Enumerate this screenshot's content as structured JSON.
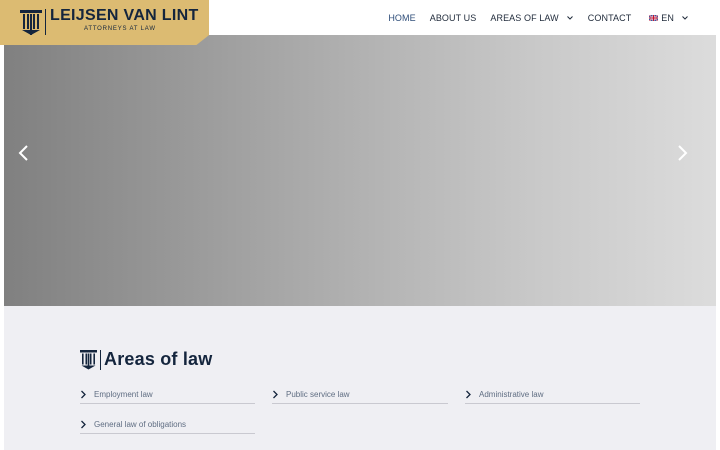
{
  "brand": {
    "name": "LEIJSEN VAN LINT",
    "tagline": "ATTORNEYS AT LAW",
    "color_gold": "#dcbb72",
    "color_navy": "#14253d"
  },
  "nav": {
    "items": [
      {
        "label": "HOME",
        "active": true
      },
      {
        "label": "ABOUT US",
        "active": false
      },
      {
        "label": "AREAS OF LAW",
        "active": false,
        "has_dropdown": true
      },
      {
        "label": "CONTACT",
        "active": false
      }
    ],
    "language": {
      "label": "EN",
      "flag": "uk-flag-icon",
      "has_dropdown": true
    }
  },
  "hero": {
    "prev_icon": "chevron-left-icon",
    "next_icon": "chevron-right-icon"
  },
  "areas": {
    "heading": "Areas of law",
    "items": [
      {
        "label": "Employment law"
      },
      {
        "label": "Public service law"
      },
      {
        "label": "Administrative law"
      },
      {
        "label": "General law of obligations"
      }
    ]
  }
}
